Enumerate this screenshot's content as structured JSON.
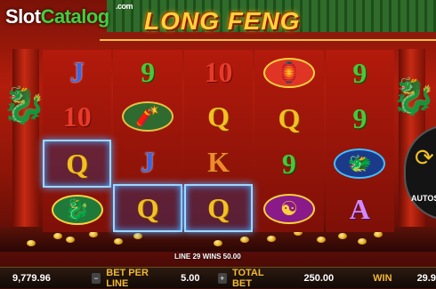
{
  "logo": {
    "slot": "Slot",
    "catalog": "Catalog",
    "com": ".com"
  },
  "game_title": "LONG FENG",
  "reels": [
    [
      {
        "kind": "card",
        "text": "J",
        "cls": "c-j"
      },
      {
        "kind": "card",
        "text": "10",
        "cls": "c-10"
      },
      {
        "kind": "card",
        "text": "Q",
        "cls": "c-q",
        "win": true
      },
      {
        "kind": "pic",
        "name": "drum-symbol",
        "glyph": "🐉",
        "cls": "drum"
      }
    ],
    [
      {
        "kind": "card",
        "text": "9",
        "cls": "c-9"
      },
      {
        "kind": "pic",
        "name": "firecracker-symbol",
        "glyph": "🧨",
        "cls": "fire"
      },
      {
        "kind": "card",
        "text": "J",
        "cls": "c-j"
      },
      {
        "kind": "card",
        "text": "Q",
        "cls": "c-q",
        "win": true
      }
    ],
    [
      {
        "kind": "card",
        "text": "10",
        "cls": "c-10"
      },
      {
        "kind": "card",
        "text": "Q",
        "cls": "c-q"
      },
      {
        "kind": "card",
        "text": "K",
        "cls": "c-k"
      },
      {
        "kind": "card",
        "text": "Q",
        "cls": "c-q",
        "win": true
      }
    ],
    [
      {
        "kind": "pic",
        "name": "lantern-fan-symbol",
        "glyph": "🏮",
        "cls": "fan"
      },
      {
        "kind": "card",
        "text": "Q",
        "cls": "c-q"
      },
      {
        "kind": "card",
        "text": "9",
        "cls": "c-9"
      },
      {
        "kind": "pic",
        "name": "coin-symbol",
        "glyph": "☯",
        "cls": "coin"
      }
    ],
    [
      {
        "kind": "card",
        "text": "9",
        "cls": "c-9"
      },
      {
        "kind": "card",
        "text": "9",
        "cls": "c-9"
      },
      {
        "kind": "pic",
        "name": "dragon-orb-symbol",
        "glyph": "🐲",
        "cls": "dragonpic"
      },
      {
        "kind": "card",
        "text": "A",
        "cls": "c-a"
      }
    ]
  ],
  "win_line": "LINE 29 WINS 50.00",
  "autospin": {
    "label": "AUTOS"
  },
  "bottom_bar": {
    "balance": "9,779.96",
    "bet_per_line_label": "BET PER LINE",
    "bet_per_line": "5.00",
    "total_bet_label": "TOTAL BET",
    "total_bet": "250.00",
    "win_label": "WIN",
    "win": "29.9"
  }
}
